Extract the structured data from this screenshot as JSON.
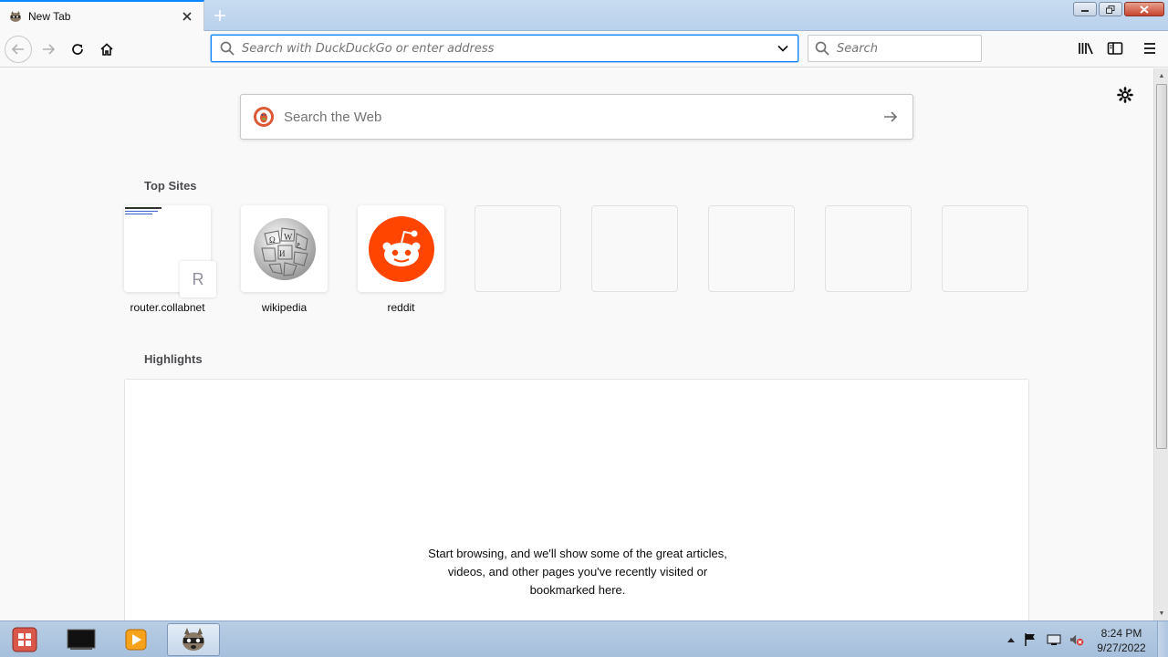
{
  "browser": {
    "tab": {
      "title": "New Tab",
      "favicon": "raccoon-icon"
    },
    "toolbar": {
      "url_placeholder": "Search with DuckDuckGo or enter address",
      "search_placeholder": "Search"
    }
  },
  "newtab": {
    "websearch_placeholder": "Search the Web",
    "top_sites_title": "Top Sites",
    "top_sites": [
      {
        "label": "router.collabnet",
        "fallback_letter": "R"
      },
      {
        "label": "wikipedia"
      },
      {
        "label": "reddit"
      },
      {
        "label": ""
      },
      {
        "label": ""
      },
      {
        "label": ""
      },
      {
        "label": ""
      },
      {
        "label": ""
      }
    ],
    "highlights_title": "Highlights",
    "highlights_empty_line1": "Start browsing, and we'll show some of the great articles,",
    "highlights_empty_line2": "videos, and other pages you've recently visited or",
    "highlights_empty_line3": "bookmarked here."
  },
  "taskbar": {
    "clock_time": "8:24 PM",
    "clock_date": "9/27/2022"
  },
  "colors": {
    "accent": "#0a84ff",
    "reddit": "#ff4500",
    "duckduckgo": "#de5833"
  }
}
